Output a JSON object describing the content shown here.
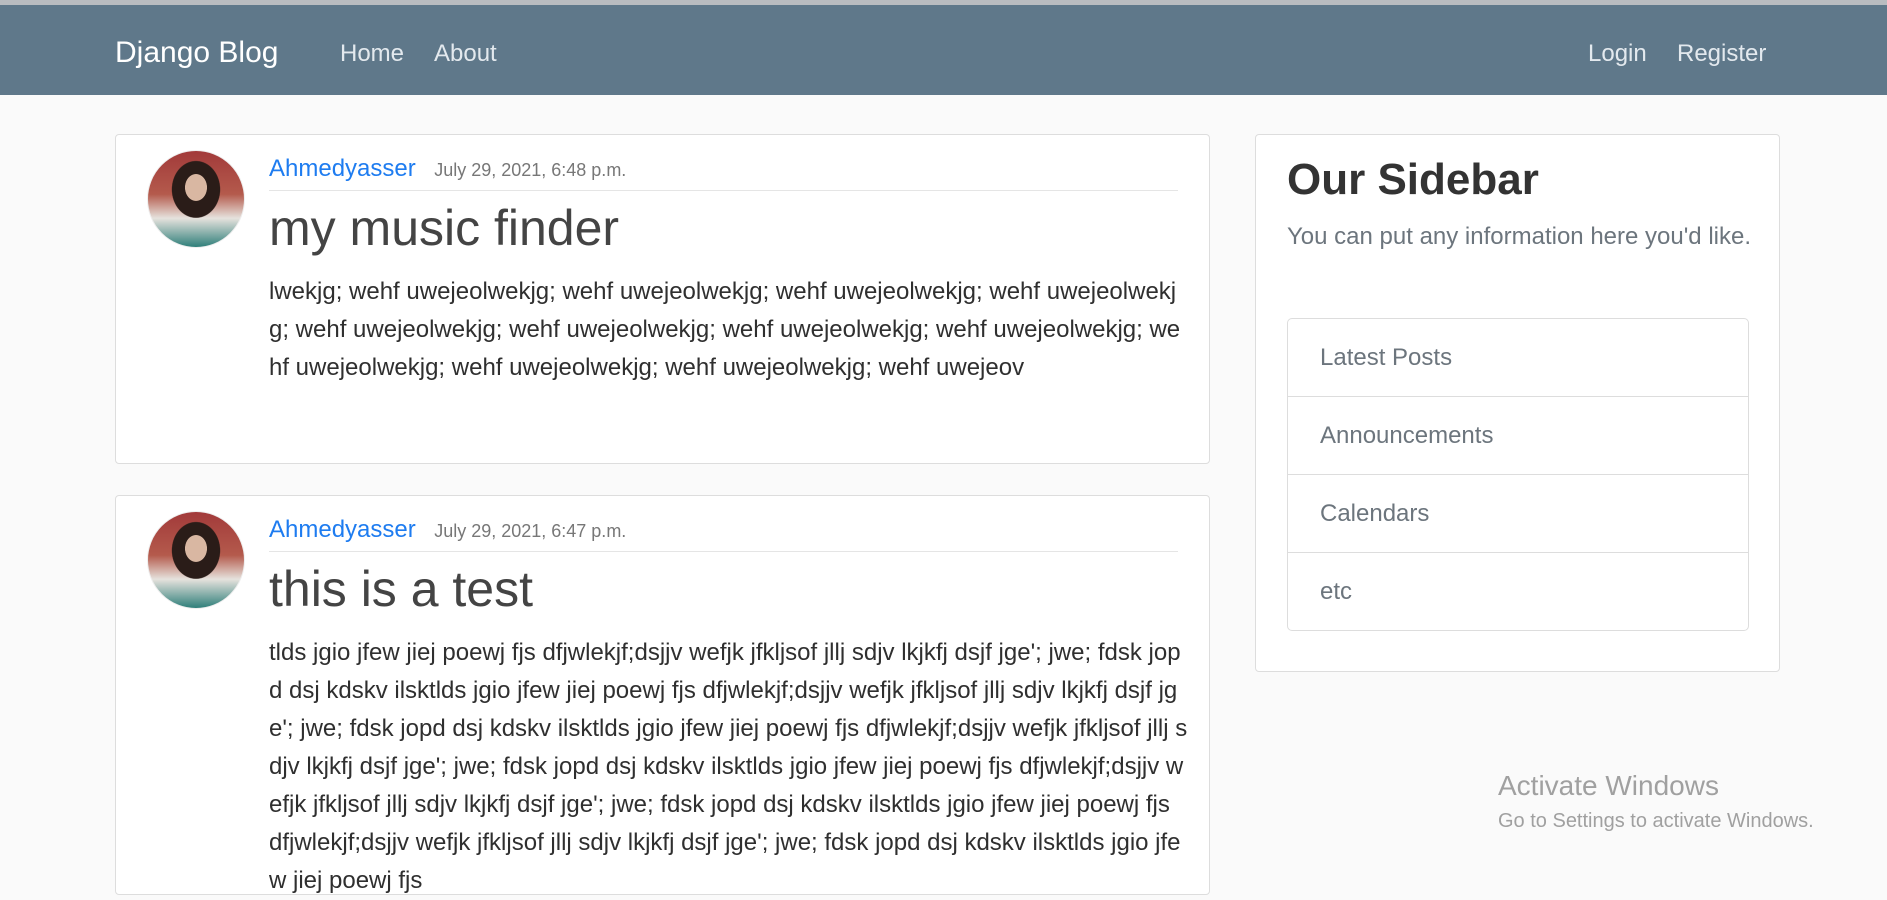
{
  "navbar": {
    "brand": "Django Blog",
    "home": "Home",
    "about": "About",
    "login": "Login",
    "register": "Register"
  },
  "posts": [
    {
      "author": "Ahmedyasser",
      "date": "July 29, 2021, 6:48 p.m.",
      "title": "my music finder",
      "content": "lwekjg; wehf uwejeolwekjg; wehf uwejeolwekjg; wehf uwejeolwekjg; wehf uwejeolwekjg; wehf uwejeolwekjg; wehf uwejeolwekjg; wehf uwejeolwekjg; wehf uwejeolwekjg; wehf uwejeolwekjg; wehf uwejeolwekjg; wehf uwejeolwekjg; wehf uwejeov"
    },
    {
      "author": "Ahmedyasser",
      "date": "July 29, 2021, 6:47 p.m.",
      "title": "this is a test",
      "content": "tlds jgio jfew jiej poewj fjs dfjwlekjf;dsjjv wefjk jfkljsof jllj sdjv lkjkfj dsjf jge'; jwe; fdsk jopd dsj kdskv ilsktlds jgio jfew jiej poewj fjs dfjwlekjf;dsjjv wefjk jfkljsof jllj sdjv lkjkfj dsjf jge'; jwe; fdsk jopd dsj kdskv ilsktlds jgio jfew jiej poewj fjs dfjwlekjf;dsjjv wefjk jfkljsof jllj sdjv lkjkfj dsjf jge'; jwe; fdsk jopd dsj kdskv ilsktlds jgio jfew jiej poewj fjs dfjwlekjf;dsjjv wefjk jfkljsof jllj sdjv lkjkfj dsjf jge'; jwe; fdsk jopd dsj kdskv ilsktlds jgio jfew jiej poewj fjs dfjwlekjf;dsjjv wefjk jfkljsof jllj sdjv lkjkfj dsjf jge'; jwe; fdsk jopd dsj kdskv ilsktlds jgio jfew jiej poewj fjs"
    }
  ],
  "sidebar": {
    "title": "Our Sidebar",
    "description": "You can put any information here you'd like.",
    "items": [
      "Latest Posts",
      "Announcements",
      "Calendars",
      "etc"
    ]
  },
  "watermark": {
    "title": "Activate Windows",
    "subtitle": "Go to Settings to activate Windows."
  },
  "colors": {
    "navbar": "#5f788a",
    "link": "#1e7cf0"
  }
}
